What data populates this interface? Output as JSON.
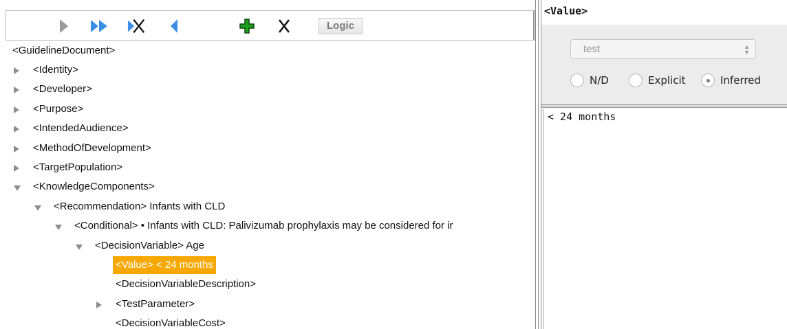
{
  "toolbar": {
    "buttons": [
      {
        "icon": "play-icon"
      },
      {
        "icon": "fast-forward-icon"
      },
      {
        "icon": "forward-clear-icon"
      },
      {
        "icon": "back-icon"
      },
      {
        "icon": "add-icon"
      },
      {
        "icon": "delete-icon"
      }
    ],
    "logic_label": "Logic"
  },
  "tree": {
    "root": "<GuidelineDocument>",
    "rows": [
      {
        "text": "<Identity>",
        "expander": "collapsed"
      },
      {
        "text": "<Developer>",
        "expander": "collapsed"
      },
      {
        "text": "<Purpose>",
        "expander": "collapsed"
      },
      {
        "text": "<IntendedAudience>",
        "expander": "collapsed"
      },
      {
        "text": "<MethodOfDevelopment>",
        "expander": "collapsed"
      },
      {
        "text": "<TargetPopulation>",
        "expander": "collapsed"
      },
      {
        "text": "<KnowledgeComponents>",
        "expander": "expanded"
      },
      {
        "text": "<Recommendation> Infants with CLD",
        "expander": "expanded"
      },
      {
        "text": "<Conditional> • Infants with CLD: Palivizumab prophylaxis may be considered for ir",
        "expander": "expanded"
      },
      {
        "text": "<DecisionVariable> Age",
        "expander": "expanded"
      },
      {
        "text": "<Value> < 24 months",
        "expander": "none",
        "selected": true
      },
      {
        "text": "<DecisionVariableDescription>",
        "expander": "none"
      },
      {
        "text": "<TestParameter>",
        "expander": "collapsed"
      },
      {
        "text": "<DecisionVariableCost>",
        "expander": "none"
      }
    ]
  },
  "detail": {
    "title": "<Value>",
    "select_value": "test",
    "radios": [
      {
        "label": "N/D",
        "checked": false
      },
      {
        "label": "Explicit",
        "checked": false
      },
      {
        "label": "Inferred",
        "checked": true
      }
    ],
    "value_text": "< 24 months"
  },
  "colors": {
    "selection": "#f6a800",
    "toolbar_blue": "#3a8ee6",
    "add_green": "#1e9e1e"
  }
}
